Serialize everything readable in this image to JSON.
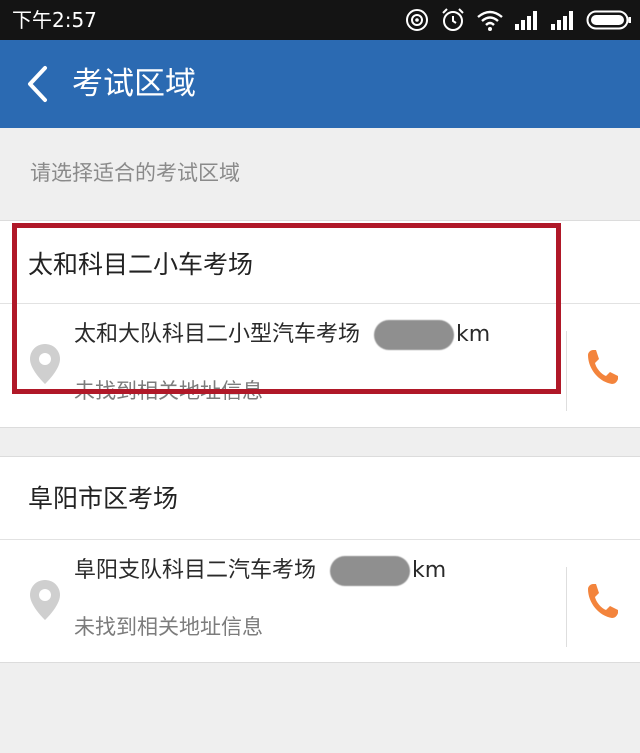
{
  "status_bar": {
    "time": "下午2:57"
  },
  "app_bar": {
    "title": "考试区域"
  },
  "hint": "请选择适合的考试区域",
  "regions": [
    {
      "title": "太和科目二小车考场",
      "place_name": "太和大队科目二小型汽车考场",
      "distance_unit": "km",
      "address": "未找到相关地址信息",
      "highlighted": true
    },
    {
      "title": "阜阳市区考场",
      "place_name": "阜阳支队科目二汽车考场",
      "distance_unit": "km",
      "address": "未找到相关地址信息",
      "highlighted": false
    }
  ],
  "colors": {
    "app_bar": "#2b6ab2",
    "phone_icon": "#f3843c",
    "highlight": "#b01828",
    "pin": "#cfcfcf"
  },
  "icons": {
    "back": "chevron-left-icon",
    "pin": "location-pin-icon",
    "phone": "phone-icon"
  }
}
